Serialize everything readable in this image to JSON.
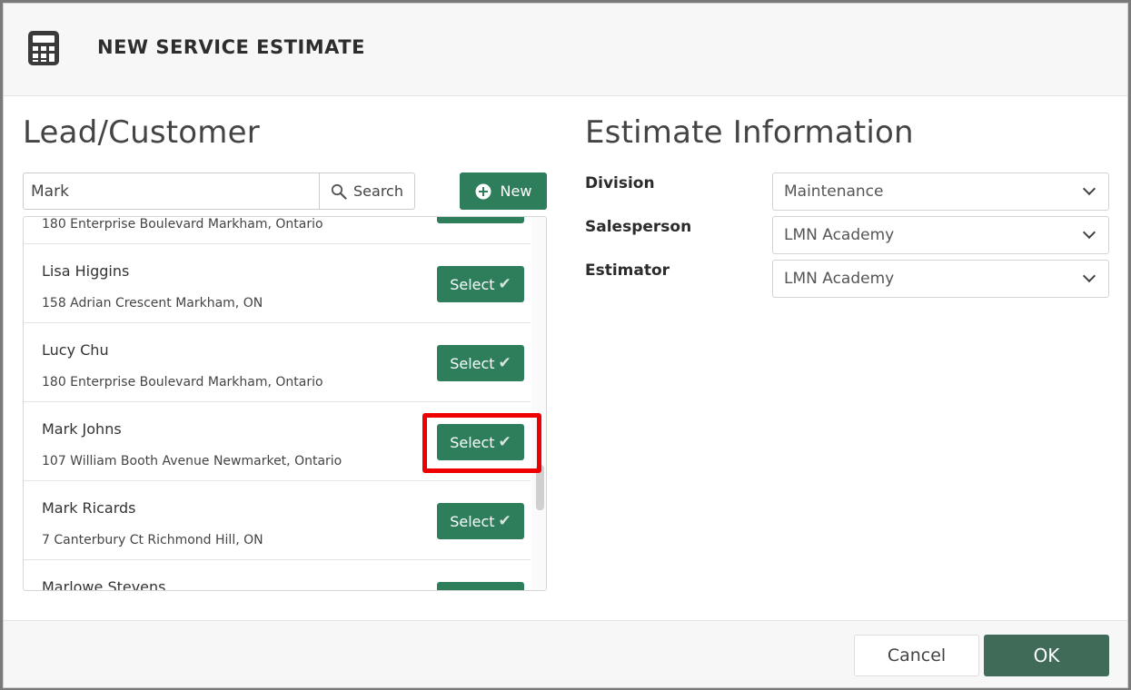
{
  "modal": {
    "title": "NEW SERVICE ESTIMATE",
    "icon": "calculator-icon"
  },
  "lead": {
    "title": "Lead/Customer",
    "search_value": "Mark",
    "search_label": "Search",
    "new_label": "New",
    "select_label": "Select",
    "items": [
      {
        "name": "",
        "address": "180 Enterprise Boulevard Markham, Ontario"
      },
      {
        "name": "Lisa Higgins",
        "address": "158 Adrian Crescent Markham, ON"
      },
      {
        "name": "Lucy Chu",
        "address": "180 Enterprise Boulevard Markham, Ontario"
      },
      {
        "name": "Mark Johns",
        "address": "107 William Booth Avenue Newmarket, Ontario"
      },
      {
        "name": "Mark Ricards",
        "address": "7 Canterbury Ct Richmond Hill, ON"
      },
      {
        "name": "Marlowe Stevens",
        "address": ""
      }
    ]
  },
  "estimate": {
    "title": "Estimate Information",
    "division_label": "Division",
    "division_value": "Maintenance",
    "salesperson_label": "Salesperson",
    "salesperson_value": "LMN Academy",
    "estimator_label": "Estimator",
    "estimator_value": "LMN Academy"
  },
  "footer": {
    "cancel_label": "Cancel",
    "ok_label": "OK"
  },
  "colors": {
    "primary_green": "#2e7d5b",
    "ok_green": "#3f6b58",
    "highlight_red": "#ee0000"
  }
}
